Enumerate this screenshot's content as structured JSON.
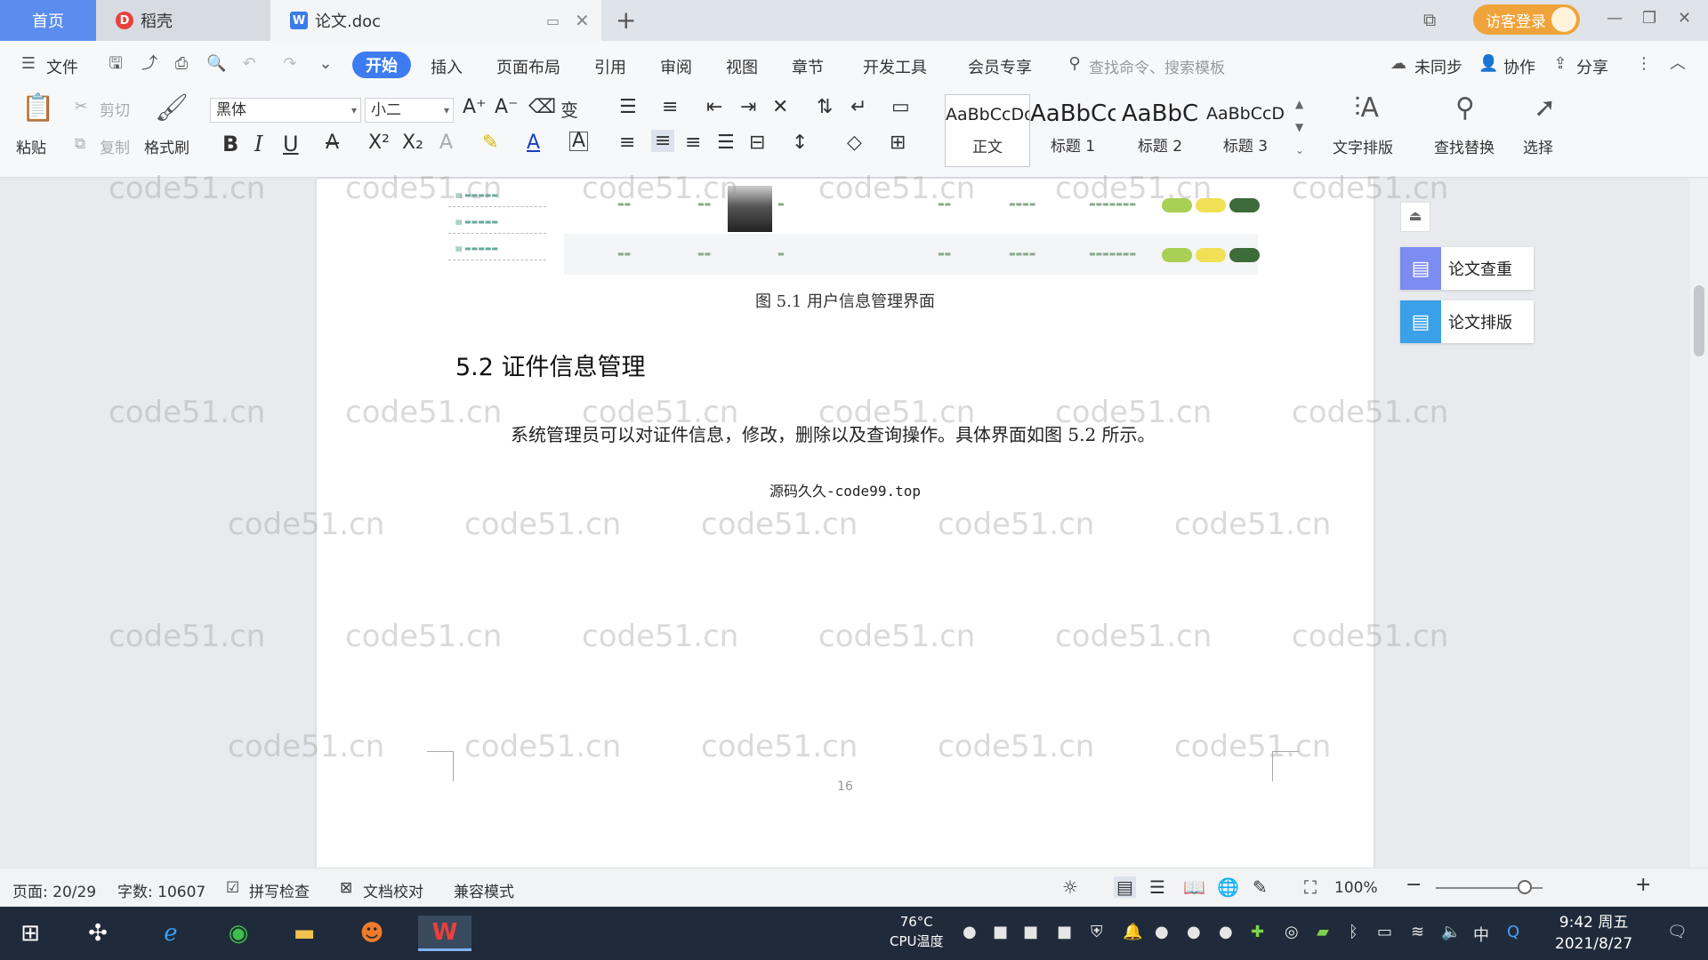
{
  "tabs": {
    "home": "首页",
    "daoke": "稻壳",
    "doc": "论文.doc",
    "login": "访客登录"
  },
  "menu": {
    "file": "文件",
    "start": "开始",
    "insert": "插入",
    "layout": "页面布局",
    "reference": "引用",
    "review": "审阅",
    "view": "视图",
    "chapter": "章节",
    "devtools": "开发工具",
    "vip": "会员专享",
    "search_placeholder": "查找命令、搜索模板",
    "unsync": "未同步",
    "collab": "协作",
    "share": "分享"
  },
  "ribbon": {
    "paste": "粘贴",
    "cut": "剪切",
    "copy": "复制",
    "format_painter": "格式刷",
    "font_name": "黑体",
    "font_size": "小二",
    "styles": [
      {
        "preview": "AaBbCcDd",
        "name": "正文"
      },
      {
        "preview": "AaBbCc",
        "name": "标题 1"
      },
      {
        "preview": "AaBbC",
        "name": "标题 2"
      },
      {
        "preview": "AaBbCcD",
        "name": "标题 3"
      }
    ],
    "text_layout": "文字排版",
    "find_replace": "查找替换",
    "select": "选择"
  },
  "document": {
    "figure_caption": "图 5.1  用户信息管理界面",
    "heading": "5.2  证件信息管理",
    "paragraph": "系统管理员可以对证件信息，修改，删除以及查询操作。具体界面如图 5.2 所示。",
    "source_line": "源码久久-code99.top",
    "page_number": "16"
  },
  "side_panel": {
    "check": "论文查重",
    "format": "论文排版"
  },
  "status": {
    "page": "页面: 20/29",
    "words": "字数: 10607",
    "spell": "拼写检查",
    "proof": "文档校对",
    "compat": "兼容模式",
    "zoom": "100%"
  },
  "taskbar": {
    "cpu_temp": "76°C",
    "cpu_label": "CPU温度",
    "time": "9:42 周五",
    "date": "2021/8/27",
    "ime": "中"
  },
  "watermark": "code51.cn",
  "colors": {
    "accent": "#3d7cf0",
    "home_tab": "#5b8def",
    "login": "#f0a33a"
  }
}
